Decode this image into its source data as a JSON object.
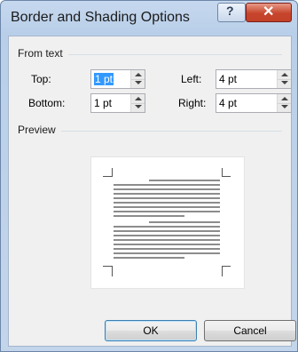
{
  "window": {
    "title": "Border and Shading Options",
    "help_glyph": "?",
    "close_glyph": "✕"
  },
  "from_text": {
    "group_label": "From text",
    "top_label": "Top:",
    "top_value": "1 pt",
    "bottom_label": "Bottom:",
    "bottom_value": "1 pt",
    "left_label": "Left:",
    "left_value": "4 pt",
    "right_label": "Right:",
    "right_value": "4 pt"
  },
  "preview": {
    "group_label": "Preview"
  },
  "buttons": {
    "ok": "OK",
    "cancel": "Cancel"
  },
  "icons": [
    "help-icon",
    "close-icon",
    "spin-up-icon",
    "spin-down-icon"
  ],
  "colors": {
    "title_bar": "#b9cfe9",
    "close_button": "#c6452c",
    "selection": "#3399ff",
    "dialog_face": "#f0f0f0"
  }
}
